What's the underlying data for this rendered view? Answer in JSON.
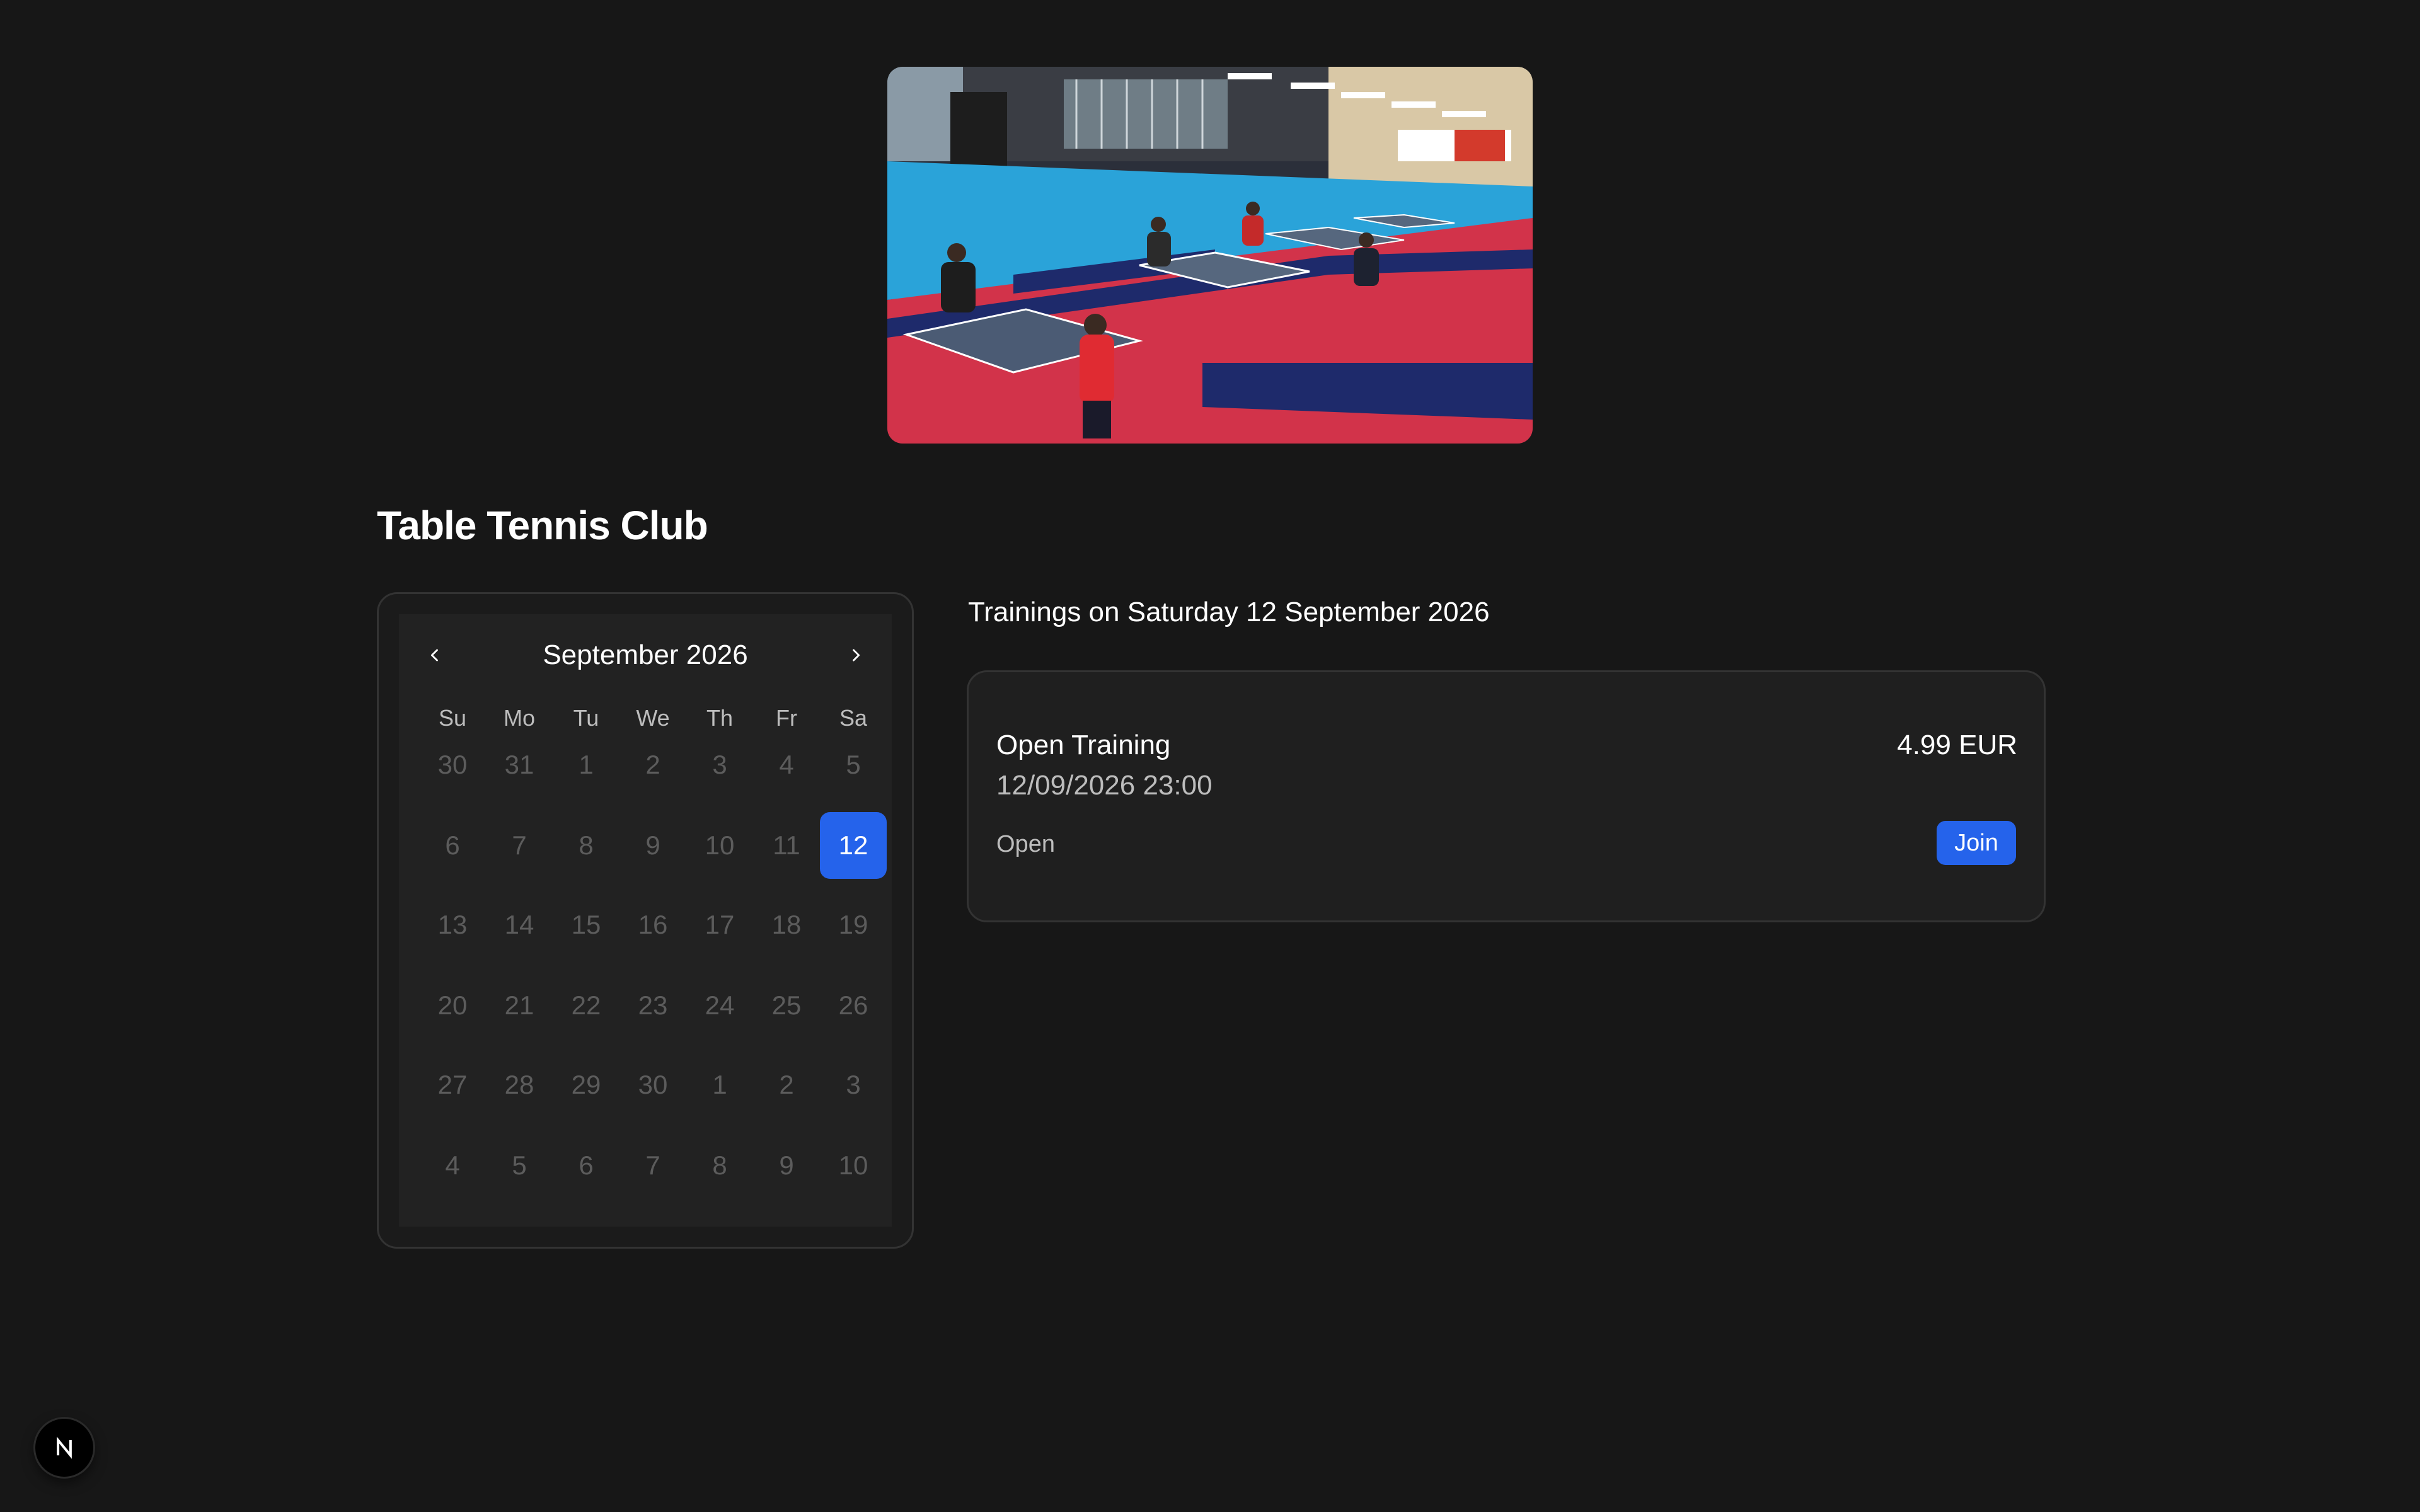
{
  "hero": {
    "image_alt": "Table tennis hall with players at tables"
  },
  "club": {
    "title": "Table Tennis Club"
  },
  "calendar": {
    "month_label": "September 2026",
    "prev_icon": "chevron-left-icon",
    "next_icon": "chevron-right-icon",
    "weekdays": [
      "Su",
      "Mo",
      "Tu",
      "We",
      "Th",
      "Fr",
      "Sa"
    ],
    "weeks": [
      [
        "30",
        "31",
        "1",
        "2",
        "3",
        "4",
        "5"
      ],
      [
        "6",
        "7",
        "8",
        "9",
        "10",
        "11",
        "12"
      ],
      [
        "13",
        "14",
        "15",
        "16",
        "17",
        "18",
        "19"
      ],
      [
        "20",
        "21",
        "22",
        "23",
        "24",
        "25",
        "26"
      ],
      [
        "27",
        "28",
        "29",
        "30",
        "1",
        "2",
        "3"
      ],
      [
        "4",
        "5",
        "6",
        "7",
        "8",
        "9",
        "10"
      ]
    ],
    "selected_day": "12",
    "selected_color": "#2563eb"
  },
  "trainings": {
    "heading": "Trainings on Saturday 12 September 2026",
    "items": [
      {
        "title": "Open Training",
        "datetime": "12/09/2026 23:00",
        "price": "4.99 EUR",
        "status": "Open",
        "action_label": "Join"
      }
    ]
  },
  "badge": {
    "letter": "N",
    "icon": "nextjs-logo-icon"
  }
}
